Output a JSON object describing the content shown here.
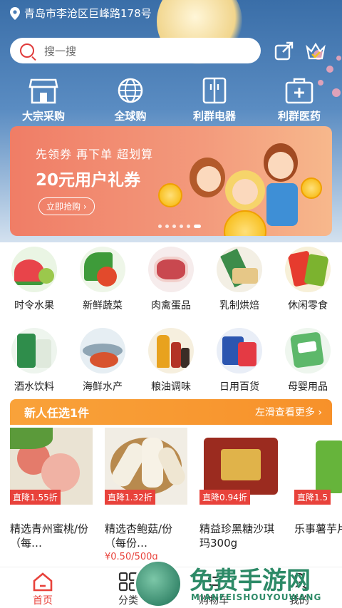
{
  "header": {
    "location": "青岛市李沧区巨峰路178号",
    "search_placeholder": "搜一搜"
  },
  "categories": [
    {
      "label": "大宗采购",
      "icon": "store-icon"
    },
    {
      "label": "全球购",
      "icon": "globe-icon"
    },
    {
      "label": "利群电器",
      "icon": "fridge-icon"
    },
    {
      "label": "利群医药",
      "icon": "medicine-kit-icon"
    }
  ],
  "banner": {
    "line1": "先领券 再下单 超划算",
    "line2": "20元用户礼券",
    "cta": "立即抢购 ›",
    "dots": 6,
    "active_dot": 5
  },
  "grid": [
    {
      "label": "时令水果",
      "icon": "watermelon-icon"
    },
    {
      "label": "新鲜蔬菜",
      "icon": "vegetable-icon"
    },
    {
      "label": "肉禽蛋品",
      "icon": "meat-icon"
    },
    {
      "label": "乳制烘焙",
      "icon": "dairy-icon"
    },
    {
      "label": "休闲零食",
      "icon": "snack-icon"
    },
    {
      "label": "酒水饮料",
      "icon": "beer-icon"
    },
    {
      "label": "海鲜水产",
      "icon": "seafood-icon"
    },
    {
      "label": "粮油调味",
      "icon": "oil-icon"
    },
    {
      "label": "日用百货",
      "icon": "daily-goods-icon"
    },
    {
      "label": "母婴用品",
      "icon": "baby-goods-icon"
    }
  ],
  "new_user": {
    "title": "新人任选1件",
    "more": "左滑查看更多 ›"
  },
  "products": [
    {
      "tag": "直降1.55折",
      "name": "精选青州蜜桃/份（每…",
      "price": ""
    },
    {
      "tag": "直降1.32折",
      "name": "精选杏鲍菇/份（每份…",
      "price": "¥0.50/500g"
    },
    {
      "tag": "直降0.94折",
      "name": "精益珍黑糖沙琪玛300g",
      "price": ""
    },
    {
      "tag": "直降1.5",
      "name": "乐事薯芋片沁",
      "price": ""
    }
  ],
  "tabbar": [
    {
      "label": "首页",
      "icon": "home-icon",
      "active": true
    },
    {
      "label": "分类",
      "icon": "category-icon",
      "active": false
    },
    {
      "label": "购物车",
      "icon": "cart-icon",
      "active": false
    },
    {
      "label": "我的",
      "icon": "user-icon",
      "active": false
    }
  ],
  "watermark": {
    "title": "免费手游网",
    "subtitle": "MIANFEISHOUYOUWANG"
  },
  "colors": {
    "accent": "#e8423b",
    "new_bar": "#f7912a",
    "hero_top": "#3a6ea8",
    "banner": "#f07d66"
  }
}
